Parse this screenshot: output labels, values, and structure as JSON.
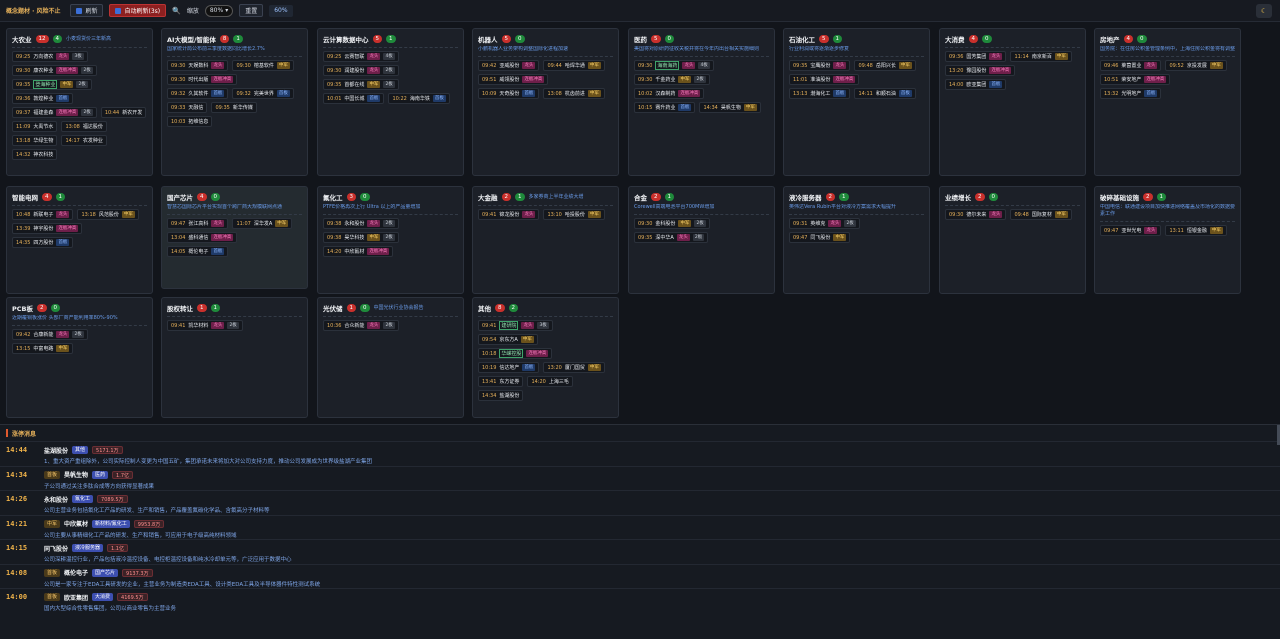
{
  "toolbar": {
    "title": "概念题材 · 风险不止",
    "refresh_label": "刷新",
    "auto_refresh_label": "自动刷新(3s)",
    "zoom_label": "缩放",
    "zoom_value": "80%",
    "reset_label": "重置",
    "pct_value": "60%"
  },
  "cards": [
    {
      "name": "大农业",
      "red": "12",
      "green": "4",
      "tag": "小麦现货价三年新高",
      "desc": "",
      "hl": false,
      "rows": [
        {
          "time": "09:25",
          "name": "万向德农",
          "tags": [
            [
              "pink",
              "龙头"
            ],
            [
              "gray",
              "3板"
            ]
          ]
        },
        {
          "time": "09:30",
          "name": "康农种业",
          "tags": [
            [
              "pink",
              "连板冲高"
            ],
            [
              "gray",
              "2板"
            ]
          ]
        },
        {
          "time": "09:35",
          "name": "登海种业",
          "boxed": true,
          "tags": [
            [
              "gold",
              "中军"
            ],
            [
              "gray",
              "2板"
            ]
          ]
        },
        {
          "time": "09:36",
          "name": "敦煌种业",
          "tags": [
            [
              "blue",
              "首板"
            ]
          ]
        },
        {
          "time": "09:37",
          "name": "福建金森",
          "tags": [
            [
              "pink",
              "连板冲高"
            ],
            [
              "gray",
              "2板"
            ]
          ]
        },
        {
          "time": "10:44",
          "name": "新农开发",
          "tags": []
        },
        {
          "time": "11:09",
          "name": "大禹节水",
          "tags": []
        },
        {
          "time": "13:08",
          "name": "福达股份",
          "tags": []
        },
        {
          "time": "13:18",
          "name": "华绿生物",
          "tags": []
        },
        {
          "time": "14:17",
          "name": "农发种业",
          "tags": []
        },
        {
          "time": "14:32",
          "name": "神农科技",
          "tags": []
        }
      ]
    },
    {
      "name": "AI大模型/智能体",
      "red": "8",
      "green": "1",
      "tag": "",
      "desc": "国家统计局公布前三季度数据同比增长2.7%",
      "hl": false,
      "rows": [
        {
          "time": "09:30",
          "name": "天娱数科",
          "tags": [
            [
              "pink",
              "龙头"
            ]
          ]
        },
        {
          "time": "09:30",
          "name": "榕基软件",
          "tags": [
            [
              "gold",
              "中军"
            ]
          ]
        },
        {
          "time": "09:30",
          "name": "时代出版",
          "tags": [
            [
              "pink",
              "连板冲高"
            ]
          ]
        },
        {
          "time": "09:32",
          "name": "久其软件",
          "tags": [
            [
              "blue",
              "首板"
            ]
          ]
        },
        {
          "time": "09:32",
          "name": "完美世界",
          "tags": [
            [
              "blue",
              "首板"
            ]
          ]
        },
        {
          "time": "09:33",
          "name": "天融信",
          "tags": []
        },
        {
          "time": "09:35",
          "name": "新华传媒",
          "tags": []
        },
        {
          "time": "10:03",
          "name": "拓维信息",
          "tags": []
        }
      ]
    },
    {
      "name": "云计算数据中心",
      "red": "5",
      "green": "1",
      "tag": "",
      "desc": "",
      "hl": false,
      "rows": [
        {
          "time": "09:25",
          "name": "云赛智联",
          "tags": [
            [
              "pink",
              "龙头"
            ],
            [
              "gray",
              "4板"
            ]
          ]
        },
        {
          "time": "09:30",
          "name": "润建股份",
          "tags": [
            [
              "pink",
              "龙头"
            ],
            [
              "gray",
              "2板"
            ]
          ]
        },
        {
          "time": "09:35",
          "name": "首都在线",
          "tags": [
            [
              "gold",
              "中军"
            ],
            [
              "gray",
              "2板"
            ]
          ]
        },
        {
          "time": "10:01",
          "name": "中国长城",
          "tags": [
            [
              "blue",
              "首板"
            ]
          ]
        },
        {
          "time": "10:22",
          "name": "海南华铁",
          "tags": [
            [
              "blue",
              "首板"
            ]
          ]
        }
      ]
    },
    {
      "name": "机器人",
      "red": "5",
      "green": "0",
      "tag": "",
      "desc": "小鹏机器人业务架构调整国际化进程加速",
      "hl": false,
      "rows": [
        {
          "time": "09:42",
          "name": "亚威股份",
          "tags": [
            [
              "pink",
              "龙头"
            ]
          ]
        },
        {
          "time": "09:44",
          "name": "哈焊华通",
          "tags": [
            [
              "gold",
              "中军"
            ]
          ]
        },
        {
          "time": "09:51",
          "name": "威领股份",
          "tags": [
            [
              "pink",
              "连板冲高"
            ]
          ]
        },
        {
          "time": "10:09",
          "name": "天奇股份",
          "tags": [
            [
              "blue",
              "首板"
            ]
          ]
        },
        {
          "time": "13:08",
          "name": "杭齿前进",
          "tags": [
            [
              "gold",
              "中军"
            ]
          ]
        }
      ]
    },
    {
      "name": "医药",
      "red": "5",
      "green": "0",
      "tag": "",
      "desc": "美国将对原研药征收关税并将在今年内出台相关实施细则",
      "hl": false,
      "rows": [
        {
          "time": "09:30",
          "name": "海南海药",
          "boxed": true,
          "tags": [
            [
              "pink",
              "龙头"
            ],
            [
              "gray",
              "4板"
            ]
          ]
        },
        {
          "time": "09:30",
          "name": "千金药业",
          "tags": [
            [
              "gold",
              "中军"
            ],
            [
              "gray",
              "2板"
            ]
          ]
        },
        {
          "time": "10:02",
          "name": "汉森制药",
          "tags": [
            [
              "pink",
              "连板冲高"
            ]
          ]
        },
        {
          "time": "10:15",
          "name": "赛升药业",
          "tags": [
            [
              "blue",
              "首板"
            ]
          ]
        },
        {
          "time": "14:34",
          "name": "昊帆生物",
          "tags": [
            [
              "gold",
              "中军"
            ]
          ]
        }
      ]
    },
    {
      "name": "石油化工",
      "red": "5",
      "green": "1",
      "tag": "",
      "desc": "行业利润或将逐渐逐步修复",
      "hl": false,
      "rows": [
        {
          "time": "09:35",
          "name": "宝鹰股份",
          "tags": [
            [
              "pink",
              "龙头"
            ]
          ]
        },
        {
          "time": "09:48",
          "name": "岳阳兴长",
          "tags": [
            [
              "gold",
              "中军"
            ]
          ]
        },
        {
          "time": "11:01",
          "name": "准油股份",
          "tags": [
            [
              "pink",
              "连板冲高"
            ]
          ]
        },
        {
          "time": "13:13",
          "name": "渤海化工",
          "tags": [
            [
              "blue",
              "首板"
            ]
          ]
        },
        {
          "time": "14:11",
          "name": "和顺石油",
          "tags": [
            [
              "blue",
              "首板"
            ]
          ]
        }
      ]
    },
    {
      "name": "大消费",
      "red": "4",
      "green": "0",
      "tag": "",
      "desc": "",
      "hl": false,
      "rows": [
        {
          "time": "09:36",
          "name": "国芳集团",
          "tags": [
            [
              "pink",
              "龙头"
            ]
          ]
        },
        {
          "time": "11:14",
          "name": "南京新百",
          "tags": [
            [
              "gold",
              "中军"
            ]
          ]
        },
        {
          "time": "13:20",
          "name": "豫园股份",
          "tags": [
            [
              "pink",
              "连板冲高"
            ]
          ]
        },
        {
          "time": "14:00",
          "name": "欧亚集团",
          "tags": [
            [
              "blue",
              "首板"
            ]
          ]
        }
      ]
    },
    {
      "name": "房地产",
      "red": "4",
      "green": "0",
      "tag": "",
      "desc": "国务院：在住房公积金管理条例中，上海住房公积金将有调整",
      "hl": false,
      "rows": [
        {
          "time": "09:46",
          "name": "莱茵置业",
          "tags": [
            [
              "pink",
              "龙头"
            ]
          ]
        },
        {
          "time": "09:52",
          "name": "京投发展",
          "tags": [
            [
              "gold",
              "中军"
            ]
          ]
        },
        {
          "time": "10:51",
          "name": "荣安地产",
          "tags": [
            [
              "pink",
              "连板冲高"
            ]
          ]
        },
        {
          "time": "13:32",
          "name": "光明地产",
          "tags": [
            [
              "blue",
              "首板"
            ]
          ]
        }
      ]
    },
    {
      "name": "智能电网",
      "red": "4",
      "green": "1",
      "tag": "",
      "desc": "",
      "hl": false,
      "rows": [
        {
          "time": "10:48",
          "name": "新联电子",
          "tags": [
            [
              "pink",
              "龙头"
            ]
          ]
        },
        {
          "time": "13:18",
          "name": "风范股份",
          "tags": [
            [
              "gold",
              "中军"
            ]
          ]
        },
        {
          "time": "13:39",
          "name": "神宇股份",
          "tags": [
            [
              "pink",
              "连板冲高"
            ]
          ]
        },
        {
          "time": "14:35",
          "name": "四方股份",
          "tags": [
            [
              "blue",
              "首板"
            ]
          ]
        }
      ]
    },
    {
      "name": "国产芯片",
      "red": "4",
      "green": "0",
      "tag": "",
      "desc": "智慧芯国际芯片平台实现首个跨厂商大规模联网点通",
      "hl": true,
      "rows": [
        {
          "time": "09:47",
          "name": "张江高科",
          "tags": [
            [
              "pink",
              "龙头"
            ]
          ]
        },
        {
          "time": "11:07",
          "name": "深华发A",
          "tags": [
            [
              "gold",
              "中军"
            ]
          ]
        },
        {
          "time": "13:04",
          "name": "盛科通信",
          "tags": [
            [
              "pink",
              "连板冲高"
            ]
          ]
        },
        {
          "time": "14:05",
          "name": "概伦电子",
          "tags": [
            [
              "blue",
              "首板"
            ]
          ]
        }
      ]
    },
    {
      "name": "氟化工",
      "red": "3",
      "green": "0",
      "tag": "",
      "desc": "PTFE价格再次上行 Ultra 以上的产品量增加",
      "hl": false,
      "rows": [
        {
          "time": "09:38",
          "name": "永和股份",
          "tags": [
            [
              "pink",
              "龙头"
            ],
            [
              "gray",
              "2板"
            ]
          ]
        },
        {
          "time": "09:38",
          "name": "昊华科技",
          "tags": [
            [
              "gold",
              "中军"
            ],
            [
              "gray",
              "2板"
            ]
          ]
        },
        {
          "time": "14:20",
          "name": "中欣氟材",
          "tags": [
            [
              "pink",
              "连板冲高"
            ]
          ]
        }
      ]
    },
    {
      "name": "大金融",
      "red": "2",
      "green": "1",
      "tag": "多家券商上半年业绩大增",
      "desc": "",
      "hl": false,
      "rows": [
        {
          "time": "09:41",
          "name": "锦龙股份",
          "tags": [
            [
              "pink",
              "龙头"
            ]
          ]
        },
        {
          "time": "13:10",
          "name": "哈投股份",
          "tags": [
            [
              "gold",
              "中军"
            ]
          ]
        }
      ]
    },
    {
      "name": "合金",
      "red": "2",
      "green": "1",
      "tag": "",
      "desc": "Corewell高端电池平台700MW增加",
      "hl": false,
      "rows": [
        {
          "time": "09:30",
          "name": "金科股份",
          "tags": [
            [
              "gold",
              "中军"
            ],
            [
              "gray",
              "2板"
            ]
          ]
        },
        {
          "time": "09:35",
          "name": "深中华A",
          "tags": [
            [
              "pink",
              "龙头"
            ],
            [
              "gray",
              "2板"
            ]
          ]
        }
      ]
    },
    {
      "name": "液冷服务器",
      "red": "2",
      "green": "1",
      "tag": "",
      "desc": "英伟达Vera Rubin平台对液冷方案需求大幅提升",
      "hl": false,
      "rows": [
        {
          "time": "09:31",
          "name": "英维克",
          "tags": [
            [
              "pink",
              "龙头"
            ],
            [
              "gray",
              "2板"
            ]
          ]
        },
        {
          "time": "09:47",
          "name": "同飞股份",
          "tags": [
            [
              "gold",
              "中军"
            ]
          ]
        }
      ]
    },
    {
      "name": "业绩增长",
      "red": "2",
      "green": "0",
      "tag": "",
      "desc": "",
      "hl": false,
      "rows": [
        {
          "time": "09:30",
          "name": "德尔未来",
          "tags": [
            [
              "pink",
              "龙头"
            ]
          ]
        },
        {
          "time": "09:48",
          "name": "国际复材",
          "tags": [
            [
              "gold",
              "中军"
            ]
          ]
        }
      ]
    },
    {
      "name": "破碎基础设施",
      "red": "2",
      "green": "1",
      "tag": "",
      "desc": "中国电信：联通建设项目加快推进网络覆盖及市场化的数据要素工作",
      "hl": false,
      "rows": [
        {
          "time": "09:47",
          "name": "亚世光电",
          "tags": [
            [
              "pink",
              "龙头"
            ]
          ]
        },
        {
          "time": "13:11",
          "name": "恒银金融",
          "tags": [
            [
              "gold",
              "中军"
            ]
          ]
        }
      ]
    },
    {
      "name": "PCB板",
      "red": "2",
      "green": "0",
      "tag": "",
      "desc": "近期覆铜板涨价 头部厂商产能利用率80%-90%",
      "hl": false,
      "rows": [
        {
          "time": "09:42",
          "name": "合康新能",
          "tags": [
            [
              "pink",
              "龙头"
            ],
            [
              "gray",
              "2板"
            ]
          ]
        },
        {
          "time": "13:15",
          "name": "中富电路",
          "tags": [
            [
              "gold",
              "中军"
            ]
          ]
        }
      ]
    },
    {
      "name": "股权转让",
      "red": "1",
      "green": "1",
      "tag": "",
      "desc": "",
      "hl": false,
      "rows": [
        {
          "time": "09:41",
          "name": "凯华材料",
          "tags": [
            [
              "pink",
              "龙头"
            ],
            [
              "gray",
              "2板"
            ]
          ]
        }
      ]
    },
    {
      "name": "光伏储",
      "red": "1",
      "green": "0",
      "tag": "中国光伏行业协会报告",
      "desc": "",
      "hl": false,
      "rows": [
        {
          "time": "10:36",
          "name": "合众新能",
          "tags": [
            [
              "pink",
              "龙头"
            ],
            [
              "gray",
              "2板"
            ]
          ]
        }
      ]
    },
    {
      "name": "其他",
      "red": "8",
      "green": "2",
      "tag": "",
      "desc": "",
      "hl": false,
      "rows": [
        {
          "time": "09:41",
          "name": "建研院",
          "boxed": true,
          "tags": [
            [
              "pink",
              "龙头"
            ],
            [
              "gray",
              "3板"
            ]
          ]
        },
        {
          "time": "09:54",
          "name": "京东方A",
          "tags": [
            [
              "gold",
              "中军"
            ]
          ]
        },
        {
          "time": "10:18",
          "name": "华嵘控股",
          "boxed": true,
          "tags": [
            [
              "pink",
              "连板冲高"
            ]
          ]
        },
        {
          "time": "10:19",
          "name": "信达地产",
          "tags": [
            [
              "blue",
              "首板"
            ]
          ]
        },
        {
          "time": "13:20",
          "name": "厦门国贸",
          "tags": [
            [
              "gold",
              "中军"
            ]
          ]
        },
        {
          "time": "13:41",
          "name": "东方证券",
          "tags": []
        },
        {
          "time": "14:20",
          "name": "上海三毛",
          "tags": []
        },
        {
          "time": "14:34",
          "name": "盐湖股份",
          "tags": []
        }
      ]
    }
  ],
  "news": {
    "title": "涨停消息",
    "items": [
      {
        "time": "14:44",
        "stock": "盐湖股份",
        "badge": "",
        "concept": "其他",
        "money": "5171.1万",
        "desc": "1、重大资产重组除外，公司实际控制人变更为中国五矿，集团承诺未来将加大对公司支持力度，推动公司发展成为世界级盐湖产业集团"
      },
      {
        "time": "14:34",
        "stock": "昊帆生物",
        "badge": "首板",
        "concept": "医药",
        "money": "1.7亿",
        "desc": "子公司通过关注多肽合成等方向获得显著成果"
      },
      {
        "time": "14:26",
        "stock": "永和股份",
        "badge": "",
        "concept": "氟化工",
        "money": "7089.5万",
        "desc": "公司主营业务包括氟化工产品的研发、生产和销售，产品覆盖氟碳化学品、含氟高分子材料等"
      },
      {
        "time": "14:21",
        "stock": "中欣氟材",
        "badge": "中军",
        "concept": "新材料/氟化工",
        "money": "9953.8万",
        "desc": "公司主要从事精细化工产品的研发、生产和销售，可应用于电子级高纯材料领域"
      },
      {
        "time": "14:15",
        "stock": "同飞股份",
        "badge": "",
        "concept": "液冷服务器",
        "money": "1.1亿",
        "desc": "公司深耕温控行业，产品包括液冷温控设备、电控柜温控设备和纯水冷却单元等，广泛应用于数据中心"
      },
      {
        "time": "14:08",
        "stock": "概伦电子",
        "badge": "首板",
        "concept": "国产芯片",
        "money": "9137.3万",
        "desc": "公司是一家专注于EDA工具研发的企业，主营业务为制造类EDA工具、设计类EDA工具及半导体器件特性测试系统"
      },
      {
        "time": "14:00",
        "stock": "欧亚集团",
        "badge": "首板",
        "concept": "大消费",
        "money": "4169.5万",
        "desc": "国内大型综合性零售集团，公司以商业零售为主营业务"
      }
    ]
  }
}
